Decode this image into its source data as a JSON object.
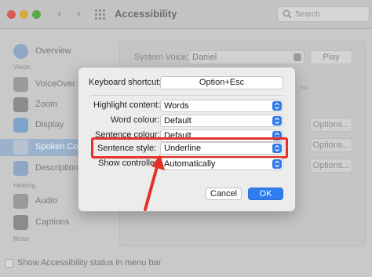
{
  "window": {
    "title": "Accessibility",
    "search_placeholder": "Search"
  },
  "sidebar": {
    "items": [
      {
        "label": "Overview",
        "icon": "info-icon"
      },
      {
        "label": "VoiceOver",
        "icon": "voiceover-icon"
      },
      {
        "label": "Zoom",
        "icon": "zoom-icon"
      },
      {
        "label": "Display",
        "icon": "display-icon"
      },
      {
        "label": "Spoken Con",
        "icon": "speech-bubble-icon",
        "selected": true
      },
      {
        "label": "Descriptions",
        "icon": "descriptions-icon"
      },
      {
        "label": "Audio",
        "icon": "speaker-icon"
      },
      {
        "label": "Captions",
        "icon": "captions-icon"
      }
    ],
    "sections": [
      "Vision",
      "Hearing",
      "Motor"
    ]
  },
  "pane": {
    "system_voice_label": "System Voice:",
    "system_voice_value": "Daniel",
    "play_label": "Play",
    "rate_tick": "Fast",
    "options_label": "Options..."
  },
  "dialog": {
    "keyboard_shortcut_label": "Keyboard shortcut:",
    "keyboard_shortcut_value": "Option+Esc",
    "highlight_content_label": "Highlight content:",
    "highlight_content_value": "Words",
    "word_colour_label": "Word colour:",
    "word_colour_value": "Default",
    "sentence_colour_label": "Sentence colour:",
    "sentence_colour_value": "Default",
    "sentence_style_label": "Sentence style:",
    "sentence_style_value": "Underline",
    "show_controller_label": "Show controller:",
    "show_controller_value": "Automatically",
    "cancel_label": "Cancel",
    "ok_label": "OK"
  },
  "status": {
    "label": "Show Accessibility status in menu bar"
  },
  "colors": {
    "accent": "#2f7df0",
    "annotation": "#e53228",
    "sidebar_selected": "#9ab2cc"
  }
}
